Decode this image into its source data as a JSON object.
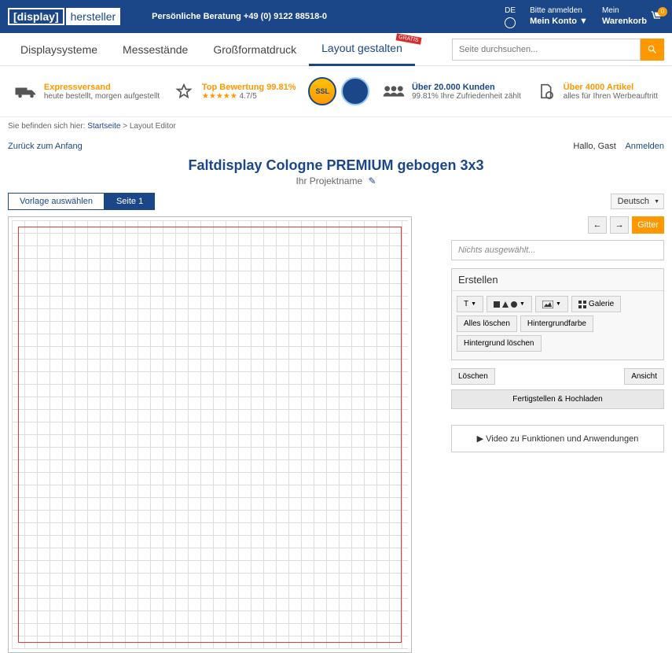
{
  "logo": {
    "part1": "[display]",
    "part2": "hersteller"
  },
  "consult": "Persönliche Beratung  +49 (0) 9122 88518-0",
  "lang": {
    "code": "DE"
  },
  "login": {
    "l1": "Bitte anmelden",
    "l2": "Mein Konto"
  },
  "cart": {
    "l1": "Mein",
    "l2": "Warenkorb",
    "count": "0"
  },
  "nav": {
    "items": [
      "Displaysysteme",
      "Messestände",
      "Großformatdruck",
      "Layout gestalten"
    ],
    "gratis": "GRATIS"
  },
  "search": {
    "placeholder": "Seite durchsuchen..."
  },
  "features": {
    "express": {
      "t1": "Expressversand",
      "t2": "heute bestellt, morgen aufgestellt"
    },
    "rating": {
      "t1": "Top Bewertung 99.81%",
      "stars": "★★★★★",
      "score": "4.7/5"
    },
    "ssl": "SSL",
    "customers": {
      "t1": "Über 20.000 Kunden",
      "t2": "99.81% Ihre Zufriedenheit zählt"
    },
    "articles": {
      "t1": "Über 4000 Artikel",
      "t2": "alles für Ihren Werbeauftritt"
    }
  },
  "breadcrumb": {
    "prefix": "Sie befinden sich hier:",
    "home": "Startseite",
    "sep": ">",
    "current": "Layout Editor"
  },
  "editor": {
    "back": "Zurück zum Anfang",
    "greeting": "Hallo, Gast",
    "login": "Anmelden",
    "title": "Faltdisplay Cologne PREMIUM gebogen 3x3",
    "subtitle": "Ihr Projektname"
  },
  "tabs": {
    "template": "Vorlage auswählen",
    "page": "Seite 1"
  },
  "langsel": "Deutsch",
  "side": {
    "grid": "Gitter",
    "nothing": "Nichts ausgewählt...",
    "create": "Erstellen",
    "text_tool": "T",
    "gallery": "Galerie",
    "clear_all": "Alles löschen",
    "bgcolor": "Hintergrundfarbe",
    "bgclear": "Hintergrund löschen",
    "delete": "Löschen",
    "view": "Ansicht",
    "finish": "Fertigstellen & Hochladen",
    "video": "Video zu Funktionen und Anwendungen"
  }
}
